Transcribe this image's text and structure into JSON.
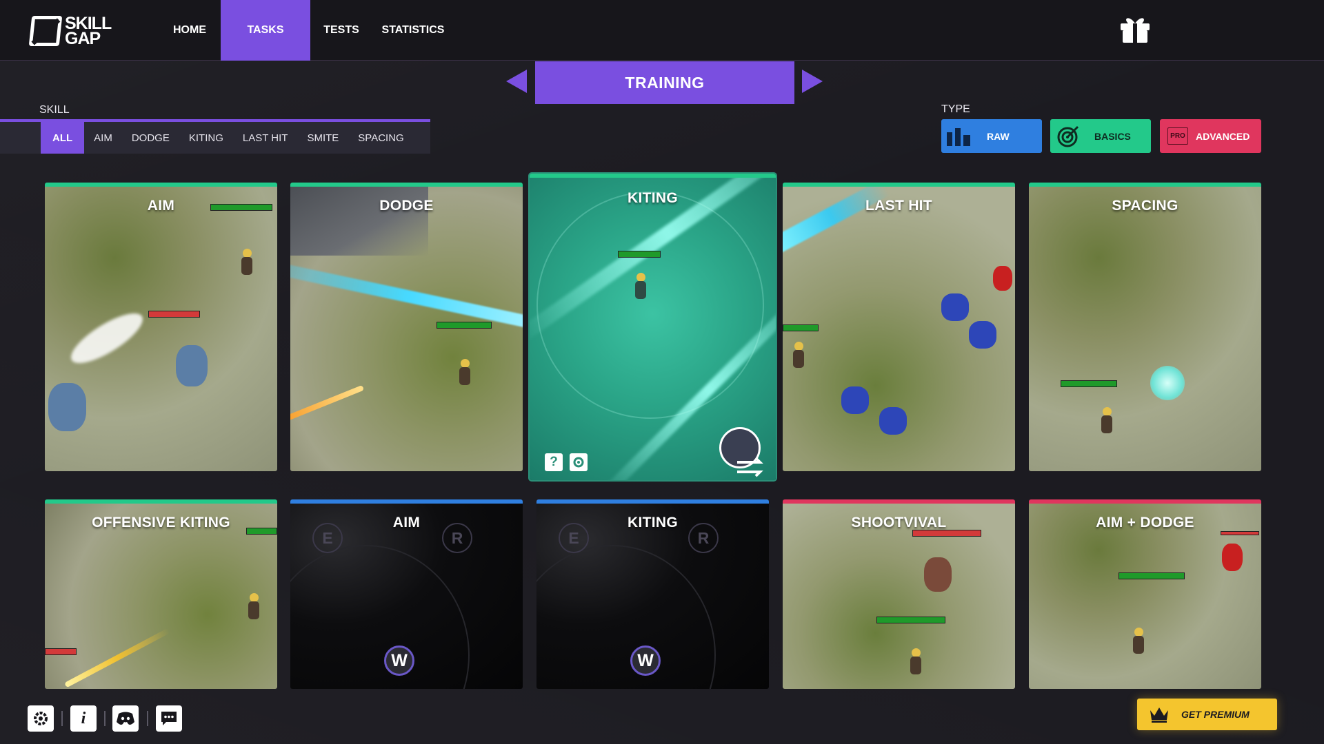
{
  "app": {
    "logo_line1": "SKILL",
    "logo_line2": "GAP"
  },
  "nav": {
    "items": [
      {
        "label": "HOME",
        "active": false
      },
      {
        "label": "TASKS",
        "active": true
      },
      {
        "label": "TESTS",
        "active": false
      },
      {
        "label": "STATISTICS",
        "active": false
      }
    ],
    "gift_icon": "gift-icon"
  },
  "mode": {
    "title": "TRAINING"
  },
  "skill_filter": {
    "label": "SKILL",
    "tabs": [
      "ALL",
      "AIM",
      "DODGE",
      "KITING",
      "LAST HIT",
      "SMITE",
      "SPACING"
    ],
    "active": "ALL"
  },
  "type_filter": {
    "label": "TYPE",
    "buttons": [
      {
        "label": "RAW",
        "color": "#2f7fe0",
        "icon": "bar-chart-icon"
      },
      {
        "label": "BASICS",
        "color": "#23c98a",
        "icon": "target-icon"
      },
      {
        "badge": "PRO",
        "label": "ADVANCED",
        "color": "#e0365e",
        "icon": "pro-badge-icon"
      }
    ]
  },
  "cards": [
    {
      "title": "AIM",
      "type": "basics"
    },
    {
      "title": "DODGE",
      "type": "basics"
    },
    {
      "title": "KITING",
      "type": "basics",
      "selected": true
    },
    {
      "title": "LAST HIT",
      "type": "basics"
    },
    {
      "title": "SPACING",
      "type": "basics"
    },
    {
      "title": "OFFENSIVE KITING",
      "type": "basics"
    },
    {
      "title": "AIM",
      "type": "raw",
      "keys": [
        "E",
        "R",
        "W"
      ]
    },
    {
      "title": "KITING",
      "type": "raw",
      "keys": [
        "E",
        "R",
        "W"
      ]
    },
    {
      "title": "SHOOTVIVAL",
      "type": "advanced"
    },
    {
      "title": "AIM + DODGE",
      "type": "advanced"
    }
  ],
  "card_controls": {
    "help": "?",
    "settings_icon": "gear-icon",
    "swap_icon": "swap-champion-icon"
  },
  "footer": {
    "icons": [
      "gear-icon",
      "info-icon",
      "discord-icon",
      "chat-icon"
    ],
    "info_glyph": "i",
    "premium_label": "GET PREMIUM"
  },
  "colors": {
    "accent": "#7a4fe0",
    "basics": "#23c98a",
    "raw": "#2f7fe0",
    "advanced": "#e0365e",
    "premium": "#f4c52e"
  }
}
